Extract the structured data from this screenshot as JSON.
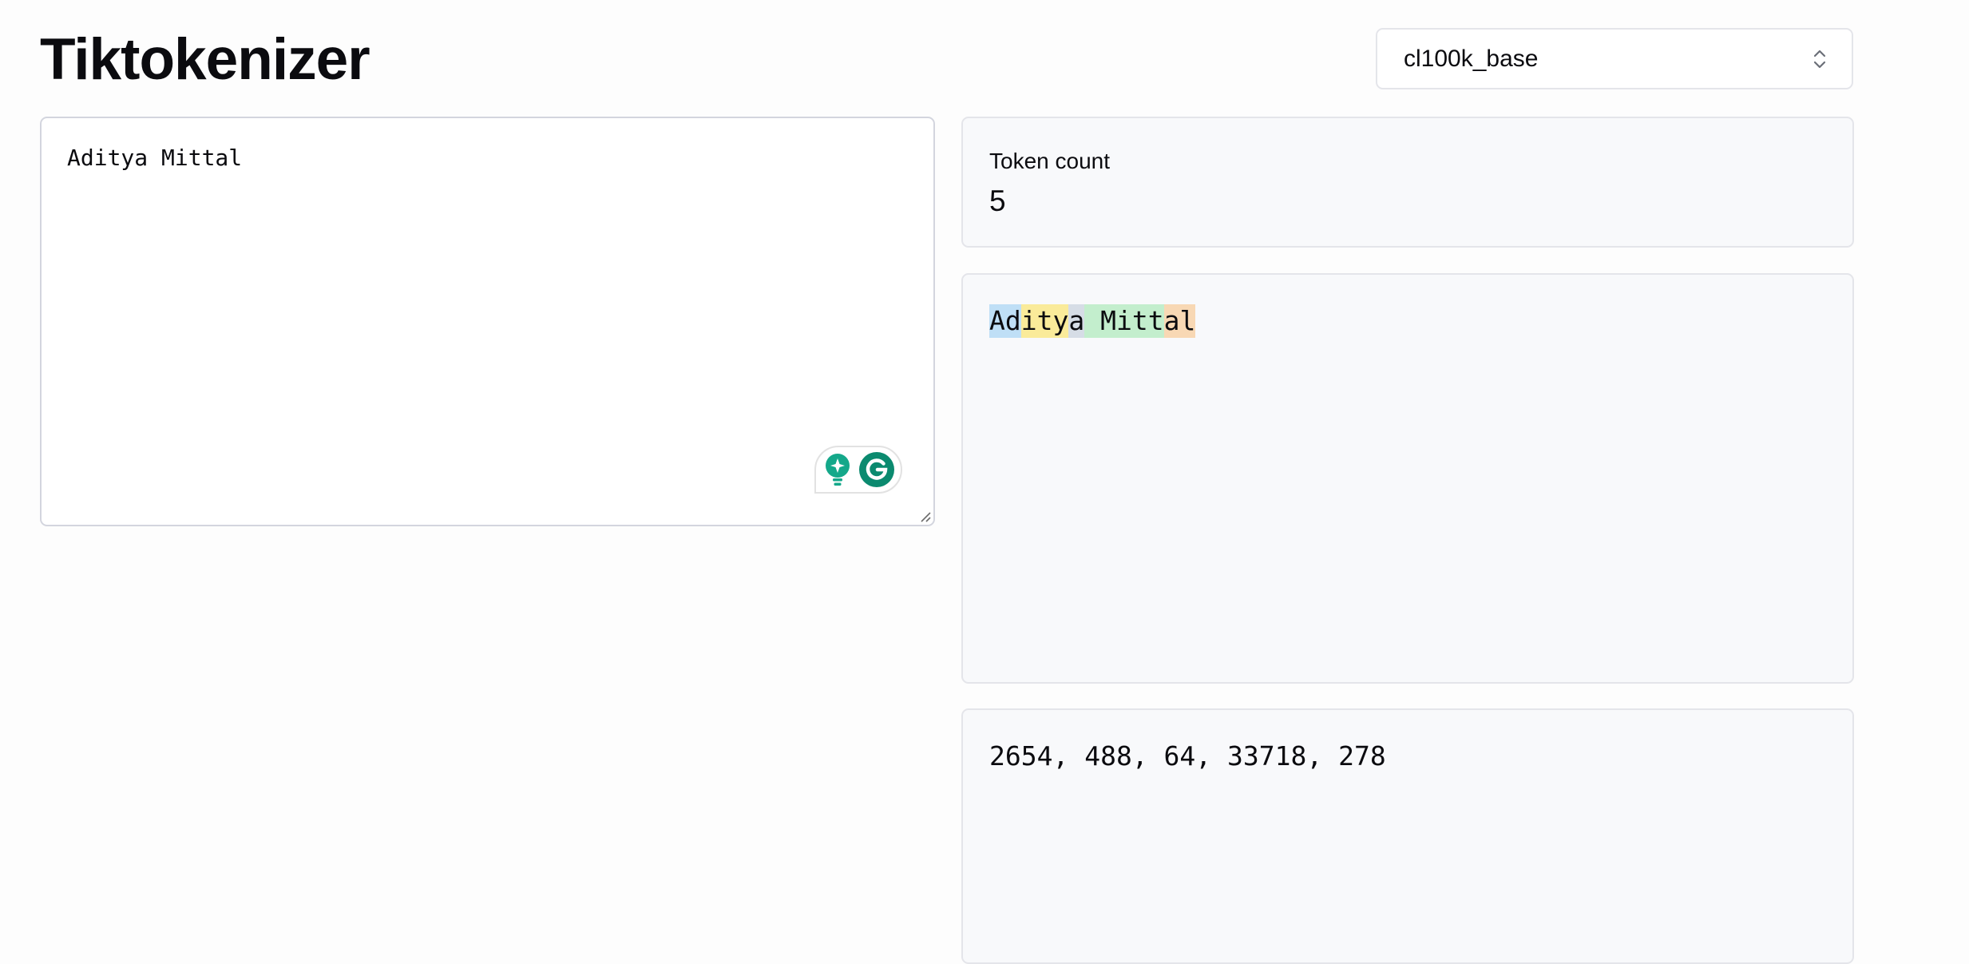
{
  "app": {
    "title": "Tiktokenizer"
  },
  "encoding_select": {
    "value": "cl100k_base",
    "icon": "chevrons-up-down-icon"
  },
  "input": {
    "text": "Aditya Mittal"
  },
  "grammarly": {
    "icons": [
      "lightbulb-sparkle-icon",
      "grammarly-g-icon"
    ],
    "color": "#0b8a6f"
  },
  "token_count": {
    "label": "Token count",
    "value": "5"
  },
  "tokens": [
    {
      "text": "Ad",
      "color": "#bfdff6"
    },
    {
      "text": "ity",
      "color": "#faeb9a"
    },
    {
      "text": "a",
      "color": "#d6dde6"
    },
    {
      "text": " Mitt",
      "color": "#c3eecd"
    },
    {
      "text": "al",
      "color": "#f8d8b4"
    }
  ],
  "token_ids": {
    "text": "2654, 488, 64, 33718, 278"
  }
}
